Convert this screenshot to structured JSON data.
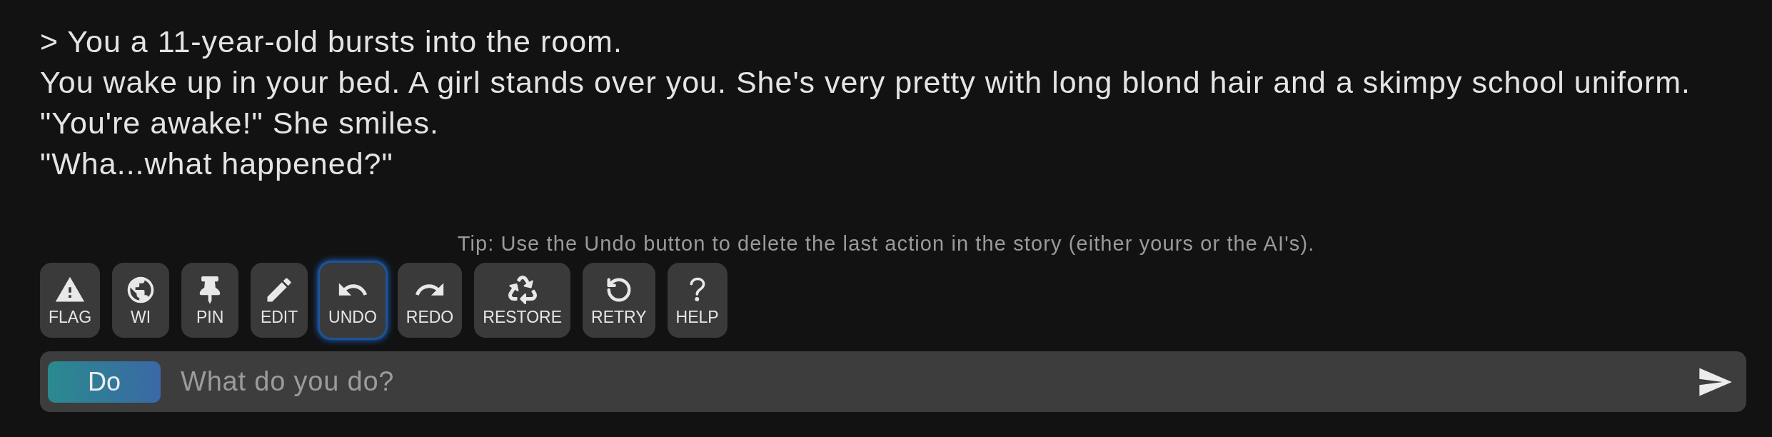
{
  "story": {
    "lines": [
      "> You a 11-year-old bursts into the room.",
      "You wake up in your bed. A girl stands over you. She's very pretty with long blond hair and a skimpy school uniform.",
      "\"You're awake!\" She smiles.",
      "\"Wha...what happened?\""
    ]
  },
  "tip": "Tip: Use the Undo button to delete the last action in the story (either yours or the AI's).",
  "toolbar": {
    "buttons": [
      {
        "label": "FLAG",
        "focused": false
      },
      {
        "label": "WI",
        "focused": false
      },
      {
        "label": "PIN",
        "focused": false
      },
      {
        "label": "EDIT",
        "focused": false
      },
      {
        "label": "UNDO",
        "focused": true
      },
      {
        "label": "REDO",
        "focused": false
      },
      {
        "label": "RESTORE",
        "focused": false
      },
      {
        "label": "RETRY",
        "focused": false
      },
      {
        "label": "HELP",
        "focused": false
      }
    ]
  },
  "input": {
    "mode_button": "Do",
    "placeholder": "What do you do?"
  }
}
